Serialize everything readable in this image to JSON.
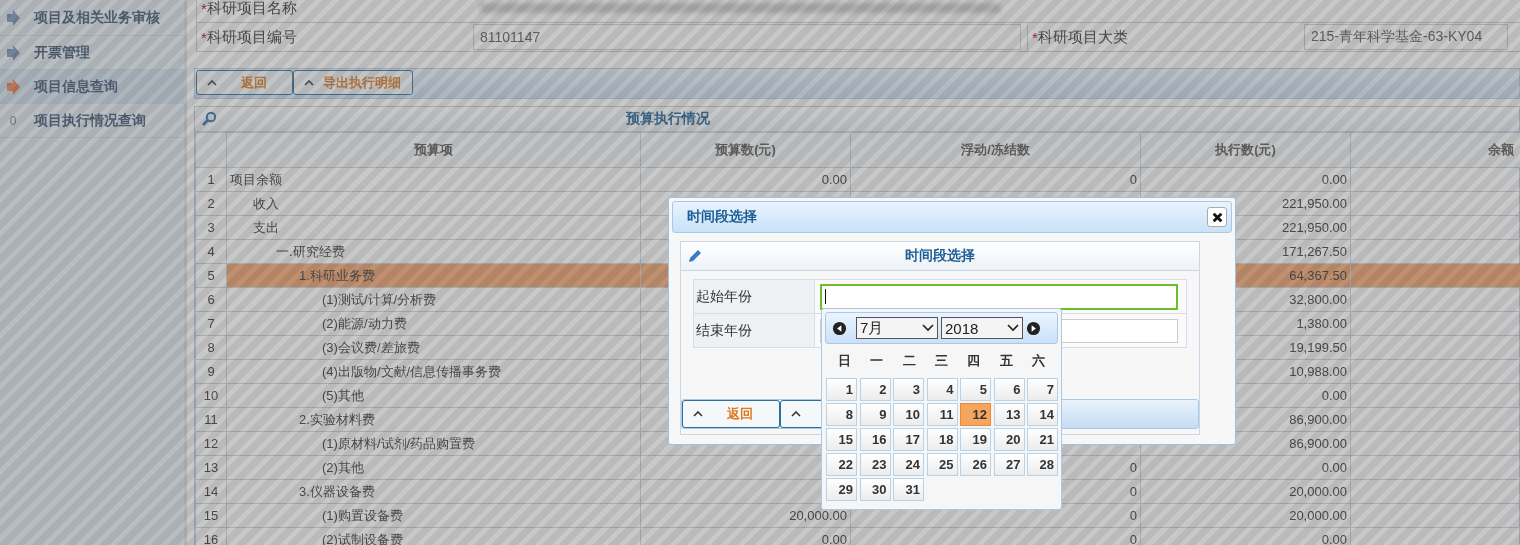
{
  "sidebar": {
    "items": [
      {
        "label": "项目及相关业务审核",
        "kind": "arrow",
        "selected": false
      },
      {
        "label": "开票管理",
        "kind": "arrow",
        "selected": false
      },
      {
        "label": "项目信息查询",
        "kind": "arrow",
        "selected": true
      },
      {
        "label": "项目执行情况查询",
        "kind": "count",
        "count": "0",
        "selected": false
      }
    ]
  },
  "form": {
    "rows": [
      {
        "fields": [
          {
            "marker": "*",
            "label": "科研项目名称"
          }
        ]
      },
      {
        "fields": [
          {
            "marker": "*",
            "label": "科研项目编号",
            "value": "81101147"
          },
          {
            "marker": "*",
            "label": "科研项目大类",
            "value": "215-青年科学基金-63-KY04"
          }
        ]
      }
    ]
  },
  "toolbar": {
    "buttons": [
      "返回",
      "导出执行明细"
    ]
  },
  "panel": {
    "title": "预算执行情况",
    "columns": [
      "预算项",
      "预算数(元)",
      "浮动/冻结数",
      "执行数(元)",
      "余额"
    ],
    "rows": [
      {
        "no": "1",
        "item": "项目余额",
        "budget": "0.00",
        "float": "0",
        "spent": "0.00",
        "selected": false,
        "children": [
          {
            "no": "2",
            "item": "收入",
            "spent": "221,950.00",
            "selected": false
          },
          {
            "no": "3",
            "item": "支出",
            "spent": "221,950.00",
            "selected": false,
            "children": [
              {
                "no": "4",
                "item": "一.研究经费",
                "spent": "171,267.50",
                "selected": false,
                "children": [
                  {
                    "no": "5",
                    "item": "1.科研业务费",
                    "spent": "64,367.50",
                    "selected": true,
                    "children": [
                      {
                        "no": "6",
                        "item": "(1)测试/计算/分析费",
                        "spent": "32,800.00",
                        "selected": false
                      },
                      {
                        "no": "7",
                        "item": "(2)能源/动力费",
                        "spent": "1,380.00",
                        "selected": false
                      },
                      {
                        "no": "8",
                        "item": "(3)会议费/差旅费",
                        "spent": "19,199.50",
                        "selected": false
                      },
                      {
                        "no": "9",
                        "item": "(4)出版物/文献/信息传播事务费",
                        "spent": "10,988.00",
                        "selected": false
                      },
                      {
                        "no": "10",
                        "item": "(5)其他",
                        "spent": "0.00",
                        "selected": false
                      }
                    ]
                  },
                  {
                    "no": "11",
                    "item": "2.实验材料费",
                    "spent": "86,900.00",
                    "selected": false,
                    "children": [
                      {
                        "no": "12",
                        "item": "(1)原材料/试剂/药品购置费",
                        "spent": "86,900.00",
                        "selected": false
                      },
                      {
                        "no": "13",
                        "item": "(2)其他",
                        "float": "0",
                        "spent": "0.00",
                        "selected": false
                      }
                    ]
                  },
                  {
                    "no": "14",
                    "item": "3.仪器设备费",
                    "float": "0",
                    "spent": "20,000.00",
                    "selected": false,
                    "children": [
                      {
                        "no": "15",
                        "item": "(1)购置设备费",
                        "budget": "20,000.00",
                        "float": "0",
                        "spent": "20,000.00",
                        "selected": false
                      },
                      {
                        "no": "16",
                        "item": "(2)试制设备费",
                        "budget": "0.00",
                        "float": "0",
                        "spent": "0.00",
                        "selected": false
                      }
                    ]
                  }
                ]
              }
            ]
          }
        ]
      }
    ]
  },
  "dialog": {
    "title": "时间段选择",
    "inner_title": "时间段选择",
    "fields": [
      {
        "label": "起始年份",
        "focused": true
      },
      {
        "label": "结束年份",
        "focused": false
      }
    ],
    "buttons": [
      "返回"
    ]
  },
  "calendar": {
    "month": "7月",
    "year": "2018",
    "weekdays": [
      "日",
      "一",
      "二",
      "三",
      "四",
      "五",
      "六"
    ],
    "days": [
      {
        "label": "1",
        "selected": false
      },
      {
        "label": "2",
        "selected": false
      },
      {
        "label": "3",
        "selected": false
      },
      {
        "label": "4",
        "selected": false
      },
      {
        "label": "5",
        "selected": false
      },
      {
        "label": "6",
        "selected": false
      },
      {
        "label": "7",
        "selected": false
      },
      {
        "label": "8",
        "selected": false
      },
      {
        "label": "9",
        "selected": false
      },
      {
        "label": "10",
        "selected": false
      },
      {
        "label": "11",
        "selected": false
      },
      {
        "label": "12",
        "selected": true
      },
      {
        "label": "13",
        "selected": false
      },
      {
        "label": "14",
        "selected": false
      },
      {
        "label": "15",
        "selected": false
      },
      {
        "label": "16",
        "selected": false
      },
      {
        "label": "17",
        "selected": false
      },
      {
        "label": "18",
        "selected": false
      },
      {
        "label": "19",
        "selected": false
      },
      {
        "label": "20",
        "selected": false
      },
      {
        "label": "21",
        "selected": false
      },
      {
        "label": "22",
        "selected": false
      },
      {
        "label": "23",
        "selected": false
      },
      {
        "label": "24",
        "selected": false
      },
      {
        "label": "25",
        "selected": false
      },
      {
        "label": "26",
        "selected": false
      },
      {
        "label": "27",
        "selected": false
      },
      {
        "label": "28",
        "selected": false
      },
      {
        "label": "29",
        "selected": false
      },
      {
        "label": "30",
        "selected": false
      },
      {
        "label": "31",
        "selected": false
      }
    ]
  }
}
